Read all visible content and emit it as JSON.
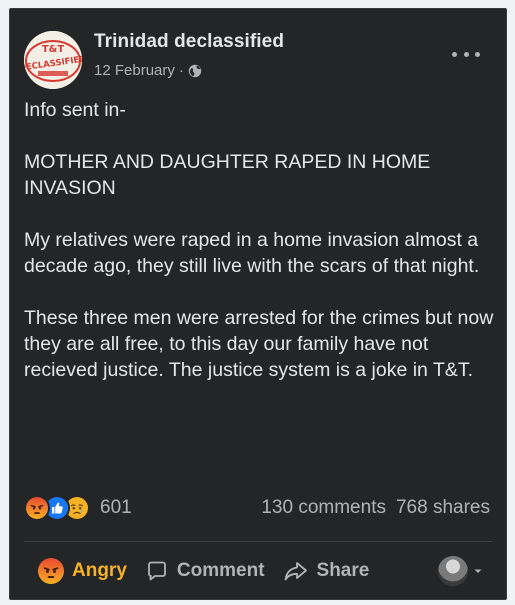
{
  "post": {
    "author": "Trinidad declassified",
    "date": "12 February",
    "separator": "·",
    "avatar_text_top": "T&T",
    "avatar_text_main": "DECLASSIFIED",
    "paragraphs": [
      "Info sent in-",
      "MOTHER AND DAUGHTER RAPED IN HOME INVASION",
      "My relatives were raped in a home invasion almost a decade ago, they still live with the scars of that night.",
      "These three men were arrested for the crimes but now they are all free, to this day our family have not recieved justice. The justice system is a joke in T&T."
    ]
  },
  "reactions": {
    "icons": [
      "angry-icon",
      "like-icon",
      "sad-icon"
    ],
    "count": "601"
  },
  "stats": {
    "comments": "130 comments",
    "shares": "768 shares"
  },
  "actions": {
    "react_label": "Angry",
    "comment_label": "Comment",
    "share_label": "Share"
  },
  "colors": {
    "card_bg": "#242526",
    "text": "#e4e6eb",
    "muted": "#b0b3b8",
    "angry": "#f7b125",
    "like": "#1877f2"
  }
}
